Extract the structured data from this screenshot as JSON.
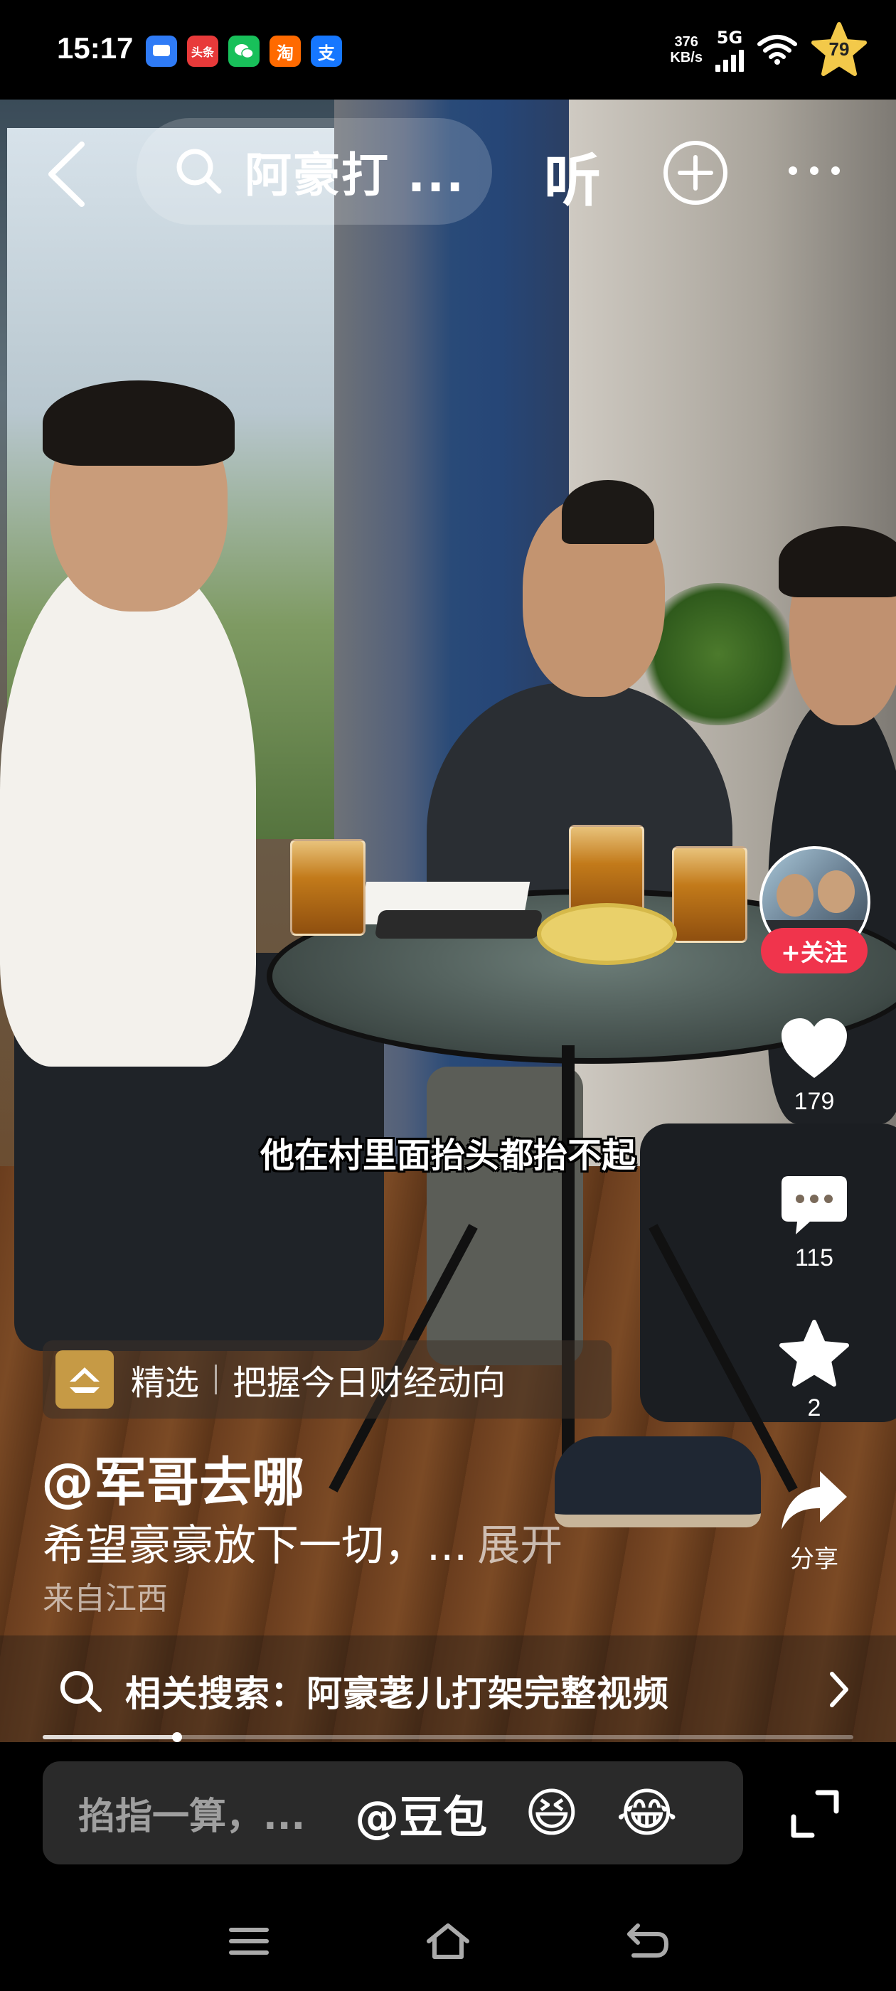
{
  "status_bar": {
    "time": "15:17",
    "apps": [
      {
        "name": "message-icon",
        "label": "",
        "color": "#2f7bf6"
      },
      {
        "name": "toutiao-icon",
        "label": "头条",
        "color": "#e83a3a"
      },
      {
        "name": "wechat-icon",
        "label": "",
        "color": "#18c05a"
      },
      {
        "name": "taobao-icon",
        "label": "淘",
        "color": "#ff6a00"
      },
      {
        "name": "alipay-icon",
        "label": "支",
        "color": "#1677ff"
      }
    ],
    "speed_value": "376",
    "speed_unit": "KB/s",
    "network": "5G",
    "battery": "79"
  },
  "top_bar": {
    "search_text": "阿豪打 ...",
    "listen_label": "听"
  },
  "video": {
    "subtitle": "他在村里面抬头都抬不起"
  },
  "rail": {
    "follow_label": "+关注",
    "like_count": "179",
    "comment_count": "115",
    "favorite_count": "2",
    "share_label": "分享"
  },
  "info": {
    "tag_label": "精选",
    "tag_text": "把握今日财经动向",
    "author": "@军哥去哪",
    "description": "希望豪豪放下一切，...",
    "expand_label": "展开",
    "location": "来自江西"
  },
  "related": {
    "text": "相关搜索：阿豪荖儿打架完整视频"
  },
  "progress": {
    "fraction": 0.166
  },
  "comment_bar": {
    "placeholder": "掐指一算，...",
    "mention": "@豆包",
    "emoji1": "😆",
    "emoji2": "😂"
  }
}
